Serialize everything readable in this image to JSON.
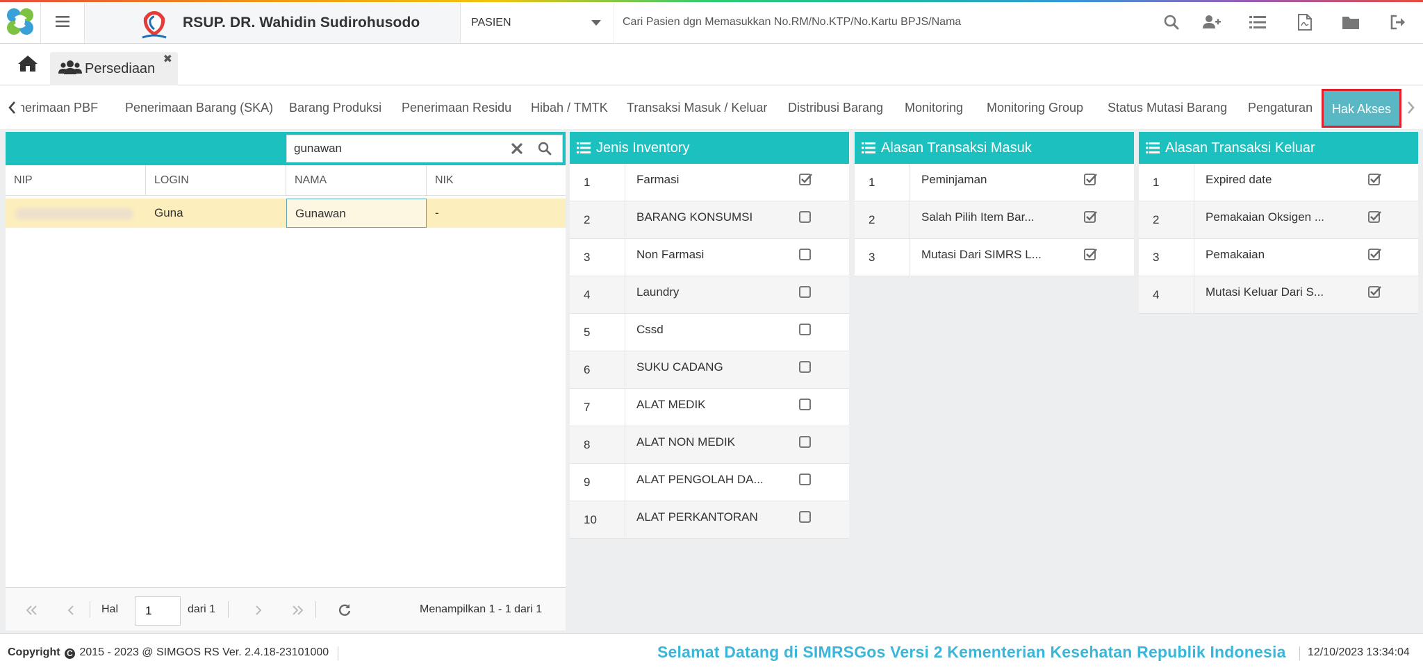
{
  "header": {
    "hospital_name": "RSUP. DR. Wahidin Sudirohusodo",
    "patient_selector": "PASIEN",
    "search_placeholder": "Cari Pasien dgn Memasukkan No.RM/No.KTP/No.Kartu BPJS/Nama",
    "icons": [
      "search-icon",
      "add-user-icon",
      "list-icon",
      "pdf-icon",
      "folder-icon",
      "logout-icon"
    ]
  },
  "tabs": {
    "home_icon": "home-icon",
    "active_tab": {
      "icon": "users-icon",
      "label": "Persediaan",
      "close": "✖"
    }
  },
  "subnav": {
    "items": [
      "Penerimaan PBF",
      "Penerimaan Barang (SKA)",
      "Barang Produksi",
      "Penerimaan Residu",
      "Hibah / TMTK",
      "Transaksi Masuk / Keluar",
      "Distribusi Barang",
      "Monitoring",
      "Monitoring Group",
      "Status Mutasi Barang",
      "Pengaturan",
      "Hak Akses"
    ],
    "active": "Hak Akses"
  },
  "users_grid": {
    "search_value": "gunawan",
    "columns": [
      "NIP",
      "LOGIN",
      "NAMA",
      "NIK"
    ],
    "rows": [
      {
        "nip": "",
        "login": "Guna",
        "nama": "Gunawan",
        "nik": "-"
      }
    ],
    "pager": {
      "hal_label": "Hal",
      "page": "1",
      "of_label": "dari 1",
      "summary": "Menampilkan 1 - 1 dari 1"
    }
  },
  "jenis_inventory": {
    "title": "Jenis Inventory",
    "rows": [
      {
        "no": "1",
        "name": "Farmasi",
        "checked": true
      },
      {
        "no": "2",
        "name": "BARANG KONSUMSI",
        "checked": false
      },
      {
        "no": "3",
        "name": "Non Farmasi",
        "checked": false
      },
      {
        "no": "4",
        "name": "Laundry",
        "checked": false
      },
      {
        "no": "5",
        "name": "Cssd",
        "checked": false
      },
      {
        "no": "6",
        "name": "SUKU CADANG",
        "checked": false
      },
      {
        "no": "7",
        "name": "ALAT MEDIK",
        "checked": false
      },
      {
        "no": "8",
        "name": "ALAT NON MEDIK",
        "checked": false
      },
      {
        "no": "9",
        "name": "ALAT PENGOLAH DA...",
        "checked": false
      },
      {
        "no": "10",
        "name": "ALAT PERKANTORAN",
        "checked": false
      }
    ]
  },
  "alasan_masuk": {
    "title": "Alasan Transaksi Masuk",
    "rows": [
      {
        "no": "1",
        "name": "Peminjaman",
        "checked": true
      },
      {
        "no": "2",
        "name": "Salah Pilih Item Bar...",
        "checked": true
      },
      {
        "no": "3",
        "name": "Mutasi Dari SIMRS L...",
        "checked": true
      }
    ]
  },
  "alasan_keluar": {
    "title": "Alasan Transaksi Keluar",
    "rows": [
      {
        "no": "1",
        "name": "Expired date",
        "checked": true
      },
      {
        "no": "2",
        "name": "Pemakaian Oksigen ...",
        "checked": true
      },
      {
        "no": "3",
        "name": "Pemakaian",
        "checked": true
      },
      {
        "no": "4",
        "name": "Mutasi Keluar Dari S...",
        "checked": true
      }
    ]
  },
  "footer": {
    "copyright_label": "Copyright",
    "copyright_text": "2015 - 2023 @ SIMGOS RS Ver. 2.4.18-23101000",
    "welcome": "Selamat Datang di SIMRSGos Versi 2 Kementerian Kesehatan Republik Indonesia",
    "datetime": "12/10/2023 13:34:04"
  },
  "colors": {
    "accent": "#1cc1bf",
    "active_tab": "#5ab7c4",
    "selected_row": "#fdeebd",
    "welcome_text": "#3ab6d8",
    "highlight_border": "#e0212b"
  }
}
